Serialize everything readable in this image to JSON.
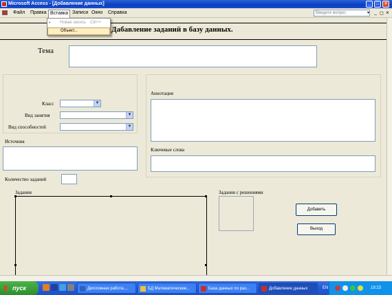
{
  "window": {
    "title": "Microsoft Access - [Добавление данных]"
  },
  "menubar": {
    "items": [
      "Файл",
      "Правка",
      "Вставка",
      "Записи",
      "Окно",
      "Справка"
    ],
    "help_placeholder": "Введите вопрос"
  },
  "dropdown": {
    "items": [
      {
        "label": "Новая запись",
        "shortcut": "Ctrl++",
        "disabled": true
      },
      {
        "label": "Объект...",
        "disabled": false
      }
    ]
  },
  "form": {
    "heading": "Дабавление заданий в базу данных.",
    "topic_label": "Тема",
    "class_label": "Класс",
    "activity_label": "Вид занятия",
    "ability_label": "Вид способностей",
    "source_label": "Источник",
    "annotation_label": "Аннотация",
    "keywords_label": "Ключевые слова",
    "task_count_label": "Количество заданий",
    "tasks_label": "Задания",
    "solutions_label": "Задания с решениями",
    "add_button": "Добавить",
    "exit_button": "Выход"
  },
  "taskbar": {
    "start": "пуск",
    "tasks": [
      "Дипломная работа....",
      "БД Математические...",
      "База данных по раз...",
      "Добавление данных"
    ],
    "lang": "EN",
    "clock": "19:23"
  },
  "colors": {
    "titlebar": "#0b3fc0",
    "form_bg": "#ece9d8",
    "taskbar": "#245edb",
    "start": "#2d8d2d"
  }
}
